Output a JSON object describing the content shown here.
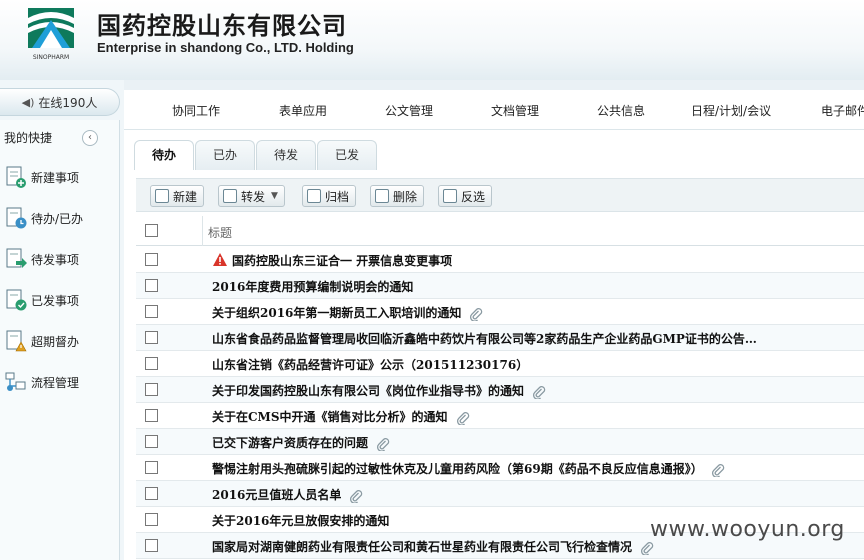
{
  "header": {
    "company_cn": "国药控股山东有限公司",
    "company_en": "Enterprise in shandong Co., LTD. Holding",
    "logo_icon": "sinopharm-logo-icon",
    "logo_text": "SINOPHARM"
  },
  "sidebar": {
    "online": "在线190人",
    "quick_title": "我的快捷",
    "items": [
      {
        "label": "新建事项",
        "icon": "new-item-icon"
      },
      {
        "label": "待办/已办",
        "icon": "clock-doc-icon"
      },
      {
        "label": "待发事项",
        "icon": "send-doc-icon"
      },
      {
        "label": "已发事项",
        "icon": "check-doc-icon"
      },
      {
        "label": "超期督办",
        "icon": "warning-doc-icon"
      },
      {
        "label": "流程管理",
        "icon": "flow-icon"
      }
    ]
  },
  "nav": {
    "items": [
      "协同工作",
      "表单应用",
      "公文管理",
      "文档管理",
      "公共信息",
      "日程/计划/会议",
      "电子邮件"
    ]
  },
  "tabs": [
    "待办",
    "已办",
    "待发",
    "已发"
  ],
  "toolbar": {
    "new": "新建",
    "forward": "转发",
    "archive": "归档",
    "delete": "删除",
    "invert": "反选"
  },
  "table": {
    "header_title": "标题",
    "rows": [
      {
        "title": "国药控股山东三证合一 开票信息变更事项",
        "warning": true,
        "attachment": false
      },
      {
        "title": "2016年度费用预算编制说明会的通知",
        "warning": false,
        "attachment": false
      },
      {
        "title": "关于组织2016年第一期新员工入职培训的通知",
        "warning": false,
        "attachment": true
      },
      {
        "title": "山东省食品药品监督管理局收回临沂鑫皓中药饮片有限公司等2家药品生产企业药品GMP证书的公告…",
        "warning": false,
        "attachment": false
      },
      {
        "title": "山东省注销《药品经营许可证》公示（201511230176）",
        "warning": false,
        "attachment": false
      },
      {
        "title": "关于印发国药控股山东有限公司《岗位作业指导书》的通知",
        "warning": false,
        "attachment": true
      },
      {
        "title": "关于在CMS中开通《销售对比分析》的通知",
        "warning": false,
        "attachment": true
      },
      {
        "title": "已交下游客户资质存在的问题",
        "warning": false,
        "attachment": true
      },
      {
        "title": "警惕注射用头孢硫脒引起的过敏性休克及儿童用药风险（第69期《药品不良反应信息通报》）",
        "warning": false,
        "attachment": true
      },
      {
        "title": "2016元旦值班人员名单",
        "warning": false,
        "attachment": true
      },
      {
        "title": "关于2016年元旦放假安排的通知",
        "warning": false,
        "attachment": false
      },
      {
        "title": "国家局对湖南健朗药业有限责任公司和黄石世星药业有限责任公司飞行检查情况",
        "warning": false,
        "attachment": true
      }
    ]
  },
  "watermark": "www.wooyun.org",
  "colors": {
    "accent": "#1b8a6b",
    "warning": "#d9352b",
    "background": "#eaf1f5"
  }
}
